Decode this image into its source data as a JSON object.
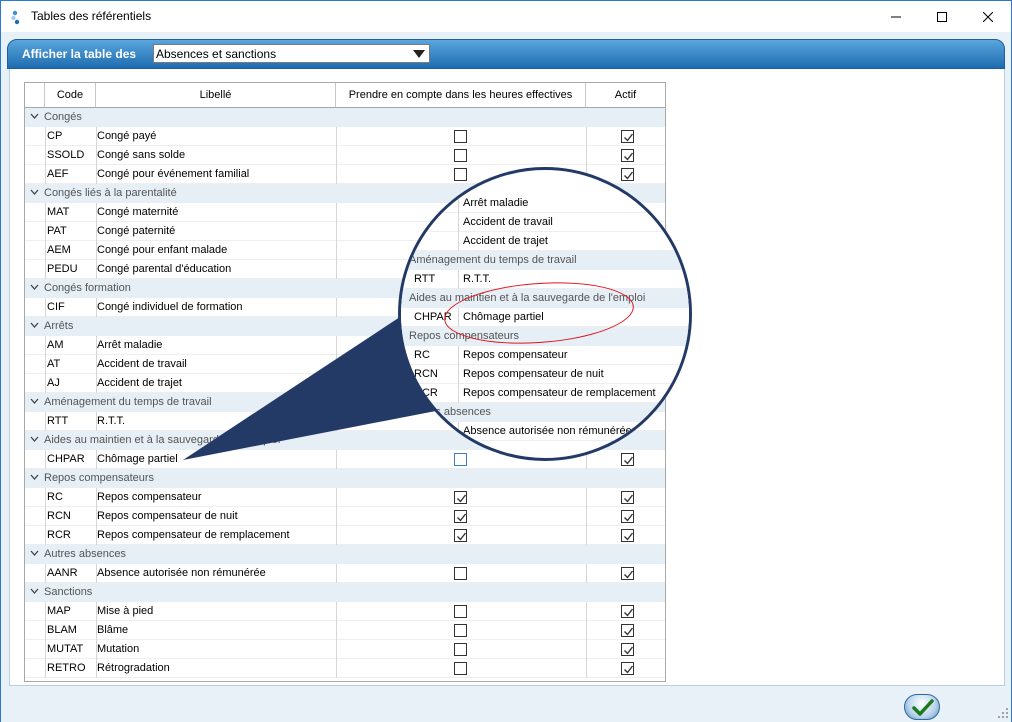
{
  "window": {
    "title": "Tables des référentiels"
  },
  "filter": {
    "label": "Afficher la table des",
    "selected": "Absences et sanctions"
  },
  "grid": {
    "headers": {
      "code": "Code",
      "libelle": "Libellé",
      "heures": "Prendre en compte dans les heures effectives",
      "actif": "Actif"
    },
    "groups": [
      {
        "label": "Congés",
        "rows": [
          {
            "code": "CP",
            "libelle": "Congé payé",
            "heures": false,
            "actif": true
          },
          {
            "code": "SSOLD",
            "libelle": "Congé sans solde",
            "heures": false,
            "actif": true
          },
          {
            "code": "AEF",
            "libelle": "Congé pour événement familial",
            "heures": false,
            "actif": true
          }
        ]
      },
      {
        "label": "Congés liés à la parentalité",
        "rows": [
          {
            "code": "MAT",
            "libelle": "Congé maternité",
            "heures": false,
            "actif": true
          },
          {
            "code": "PAT",
            "libelle": "Congé paternité",
            "heures": false,
            "actif": true
          },
          {
            "code": "AEM",
            "libelle": "Congé pour enfant malade",
            "heures": false,
            "actif": true
          },
          {
            "code": "PEDU",
            "libelle": "Congé parental d'éducation",
            "heures": false,
            "actif": true
          }
        ]
      },
      {
        "label": "Congés formation",
        "rows": [
          {
            "code": "CIF",
            "libelle": "Congé individuel de formation",
            "heures": false,
            "actif": true
          }
        ]
      },
      {
        "label": "Arrêts",
        "rows": [
          {
            "code": "AM",
            "libelle": "Arrêt maladie",
            "heures": false,
            "actif": true
          },
          {
            "code": "AT",
            "libelle": "Accident de travail",
            "heures": false,
            "actif": true
          },
          {
            "code": "AJ",
            "libelle": "Accident de trajet",
            "heures": false,
            "actif": true
          }
        ]
      },
      {
        "label": "Aménagement du temps de travail",
        "rows": [
          {
            "code": "RTT",
            "libelle": "R.T.T.",
            "heures": false,
            "actif": true
          }
        ]
      },
      {
        "label": "Aides au maintien et à la sauvegarde de l'emploi",
        "rows": [
          {
            "code": "CHPAR",
            "libelle": "Chômage partiel",
            "heures": false,
            "actif": true
          }
        ]
      },
      {
        "label": "Repos compensateurs",
        "rows": [
          {
            "code": "RC",
            "libelle": "Repos compensateur",
            "heures": true,
            "actif": true
          },
          {
            "code": "RCN",
            "libelle": "Repos compensateur de nuit",
            "heures": true,
            "actif": true
          },
          {
            "code": "RCR",
            "libelle": "Repos compensateur de remplacement",
            "heures": true,
            "actif": true
          }
        ]
      },
      {
        "label": "Autres absences",
        "rows": [
          {
            "code": "AANR",
            "libelle": "Absence autorisée non rémunérée",
            "heures": false,
            "actif": true
          }
        ]
      },
      {
        "label": "Sanctions",
        "rows": [
          {
            "code": "MAP",
            "libelle": "Mise à pied",
            "heures": false,
            "actif": true
          },
          {
            "code": "BLAM",
            "libelle": "Blâme",
            "heures": false,
            "actif": true
          },
          {
            "code": "MUTAT",
            "libelle": "Mutation",
            "heures": false,
            "actif": true
          },
          {
            "code": "RETRO",
            "libelle": "Rétrogradation",
            "heures": false,
            "actif": true
          }
        ]
      }
    ]
  },
  "magnifier": {
    "rows": [
      {
        "type": "data",
        "code": "",
        "libelle": "Arrêt maladie",
        "check": true
      },
      {
        "type": "data",
        "code": "",
        "libelle": "Accident de travail"
      },
      {
        "type": "data",
        "code": "",
        "libelle": "Accident de trajet"
      },
      {
        "type": "group",
        "label": "Aménagement du temps de travail"
      },
      {
        "type": "data",
        "code": "RTT",
        "libelle": "R.T.T."
      },
      {
        "type": "group",
        "label": "Aides au maintien et à la sauvegarde de l'emploi"
      },
      {
        "type": "data",
        "code": "CHPAR",
        "libelle": "Chômage partiel"
      },
      {
        "type": "group",
        "label": "Repos compensateurs"
      },
      {
        "type": "data",
        "code": "RC",
        "libelle": "Repos compensateur"
      },
      {
        "type": "data",
        "code": "RCN",
        "libelle": "Repos compensateur de nuit"
      },
      {
        "type": "data",
        "code": "RCR",
        "libelle": "Repos compensateur de remplacement"
      },
      {
        "type": "group",
        "label": "Autres absences"
      },
      {
        "type": "data",
        "code": "",
        "libelle": "Absence autorisée non rémunérée",
        "check": true
      }
    ]
  },
  "icons": {
    "ok": "checkmark-icon",
    "close": "close-icon",
    "maximize": "maximize-icon",
    "minimize": "minimize-icon"
  },
  "colors": {
    "accent": "#1e6cb0",
    "callout": "#243a66",
    "highlight": "#e0141a"
  }
}
